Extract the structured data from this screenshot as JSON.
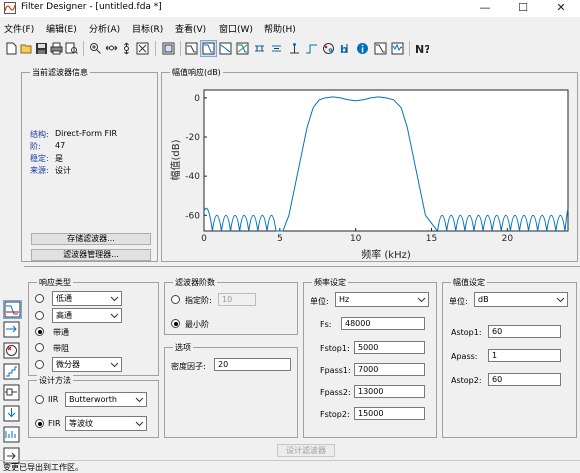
{
  "window": {
    "title": "Filter Designer - [untitled.fda *]",
    "minimize": "—",
    "maximize": "☐",
    "close": "✕"
  },
  "menu": [
    {
      "label": "文件(F)"
    },
    {
      "label": "编辑(E)"
    },
    {
      "label": "分析(A)"
    },
    {
      "label": "目标(R)"
    },
    {
      "label": "查看(V)"
    },
    {
      "label": "窗口(W)"
    },
    {
      "label": "帮助(H)"
    }
  ],
  "toolbar": {
    "icons": [
      "new-icon",
      "open-icon",
      "save-icon",
      "print-icon",
      "print-preview-icon",
      "zoom-in-icon",
      "zoom-x-icon",
      "zoom-y-icon",
      "full-view-icon",
      "full-view-analysis-icon",
      "magnitude-response-icon",
      "phase-response-icon",
      "magnitude-phase-icon",
      "group-delay-icon",
      "phase-delay-icon",
      "impulse-response-icon",
      "step-response-icon",
      "pole-zero-icon",
      "filter-coefficients-icon",
      "filter-info-icon",
      "magnitude-estimate-icon",
      "round-off-noise-icon",
      "help-icon"
    ]
  },
  "filter_info": {
    "group_title": "当前滤波器信息",
    "rows": [
      {
        "key": "结构:",
        "value": "Direct-Form FIR"
      },
      {
        "key": "阶:",
        "value": "47"
      },
      {
        "key": "稳定:",
        "value": "是"
      },
      {
        "key": "来源:",
        "value": "设计"
      }
    ],
    "store_button": "存储滤波器...",
    "manager_button": "滤波器管理器..."
  },
  "plot_panel": {
    "group_title": "幅值响应(dB)"
  },
  "chart_data": {
    "type": "line",
    "title": "",
    "xlabel": "频率 (kHz)",
    "ylabel": "幅值(dB)",
    "xlim": [
      0,
      24
    ],
    "ylim": [
      -68,
      4
    ],
    "xticks": [
      0,
      5,
      10,
      15,
      20
    ],
    "yticks": [
      0,
      -20,
      -40,
      -60
    ],
    "grid": false,
    "series": [
      {
        "name": "",
        "color": "#0072bd",
        "x": [
          0,
          0.55,
          1.15,
          1.75,
          2.35,
          2.95,
          3.55,
          4.15,
          4.75,
          5.2,
          5.6,
          6.0,
          6.4,
          6.8,
          7.2,
          7.6,
          8.0,
          8.5,
          9.0,
          9.5,
          10.0,
          10.5,
          11.0,
          11.5,
          12.0,
          12.5,
          13.0,
          13.4,
          13.8,
          14.2,
          14.6,
          15.0,
          15.4,
          15.8,
          16.4,
          17.0,
          17.6,
          18.2,
          18.8,
          19.4,
          20.0,
          20.6,
          21.2,
          21.8,
          22.4,
          23.0,
          23.6,
          24.0
        ],
        "y": [
          -60,
          -68,
          -68,
          -68,
          -68,
          -68,
          -68,
          -68,
          -68,
          -68,
          -60,
          -45,
          -30,
          -15,
          -5,
          -1,
          0,
          0.5,
          0,
          -1,
          -1.5,
          -1,
          0,
          0.5,
          0,
          -1,
          -5,
          -15,
          -30,
          -45,
          -60,
          -68,
          -68,
          -68,
          -68,
          -68,
          -68,
          -68,
          -68,
          -68,
          -68,
          -68,
          -68,
          -68,
          -68,
          -68,
          -68,
          -62
        ],
        "stopband_lobe_peak_db": -58,
        "stopband_lobe_nulls_x": [
          0.55,
          1.15,
          1.75,
          2.35,
          2.95,
          3.55,
          4.15,
          4.75,
          15.4,
          16.0,
          16.6,
          17.2,
          17.8,
          18.4,
          19.0,
          19.6,
          20.2,
          20.8,
          21.4,
          22.0,
          22.6,
          23.2,
          23.8
        ]
      }
    ]
  },
  "response_type": {
    "group_title": "响应类型",
    "options": [
      {
        "label": "低通",
        "selected": false,
        "dropdown": true
      },
      {
        "label": "高通",
        "selected": false,
        "dropdown": true
      },
      {
        "label": "带通",
        "selected": true,
        "dropdown": false
      },
      {
        "label": "带阻",
        "selected": false,
        "dropdown": false
      },
      {
        "label": "微分器",
        "selected": false,
        "dropdown": true
      }
    ]
  },
  "design_method": {
    "group_title": "设计方法",
    "iir_label": "IIR",
    "iir_value": "Butterworth",
    "iir_selected": false,
    "fir_label": "FIR",
    "fir_value": "等波纹",
    "fir_selected": true
  },
  "filter_order": {
    "group_title": "滤波器阶数",
    "specify_label": "指定阶:",
    "specify_value": "10",
    "specify_selected": false,
    "minimum_label": "最小阶",
    "minimum_selected": true
  },
  "options": {
    "group_title": "选项",
    "density_label": "密度因子:",
    "density_value": "20"
  },
  "freq_spec": {
    "group_title": "频率设定",
    "unit_label": "单位:",
    "unit_value": "Hz",
    "fields": [
      {
        "label": "Fs:",
        "value": "48000"
      },
      {
        "label": "Fstop1:",
        "value": "5000"
      },
      {
        "label": "Fpass1:",
        "value": "7000"
      },
      {
        "label": "Fpass2:",
        "value": "13000"
      },
      {
        "label": "Fstop2:",
        "value": "15000"
      }
    ]
  },
  "mag_spec": {
    "group_title": "幅值设定",
    "unit_label": "单位:",
    "unit_value": "dB",
    "fields": [
      {
        "label": "Astop1:",
        "value": "60"
      },
      {
        "label": "Apass:",
        "value": "1"
      },
      {
        "label": "Astop2:",
        "value": "60"
      }
    ]
  },
  "design_button": "设计滤波器",
  "side_icons": [
    "design-filter-icon",
    "transform-filter-icon",
    "pole-zero-editor-icon",
    "quantize-icon",
    "realize-model-icon",
    "import-filter-icon",
    "multirate-icon",
    "export-icon"
  ],
  "status_bar": "变更已导出到工作区。"
}
